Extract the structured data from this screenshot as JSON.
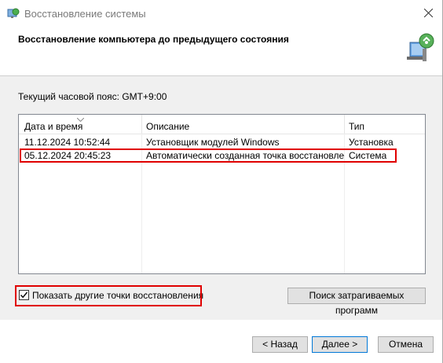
{
  "window": {
    "title": "Восстановление системы",
    "header_title": "Восстановление компьютера до предыдущего состояния"
  },
  "timezone": {
    "label": "Текущий часовой пояс: GMT+9:00"
  },
  "list": {
    "columns": [
      "Дата и время",
      "Описание",
      "Тип"
    ],
    "rows": [
      {
        "date": "11.12.2024 10:52:44",
        "description": "Установщик модулей Windows",
        "type": "Установка"
      },
      {
        "date": "05.12.2024 20:45:23",
        "description": "Автоматически созданная точка восстановле...",
        "type": "Система"
      }
    ]
  },
  "options": {
    "show_more_label": "Показать другие точки восстановления",
    "show_more_checked": true
  },
  "buttons": {
    "scan_affected": "Поиск затрагиваемых программ",
    "back": "< Назад",
    "next": "Далее >",
    "cancel": "Отмена"
  },
  "colors": {
    "highlight": "#e00000",
    "dialog_bg": "#f0f0f0",
    "accent_border": "#0078d7"
  }
}
